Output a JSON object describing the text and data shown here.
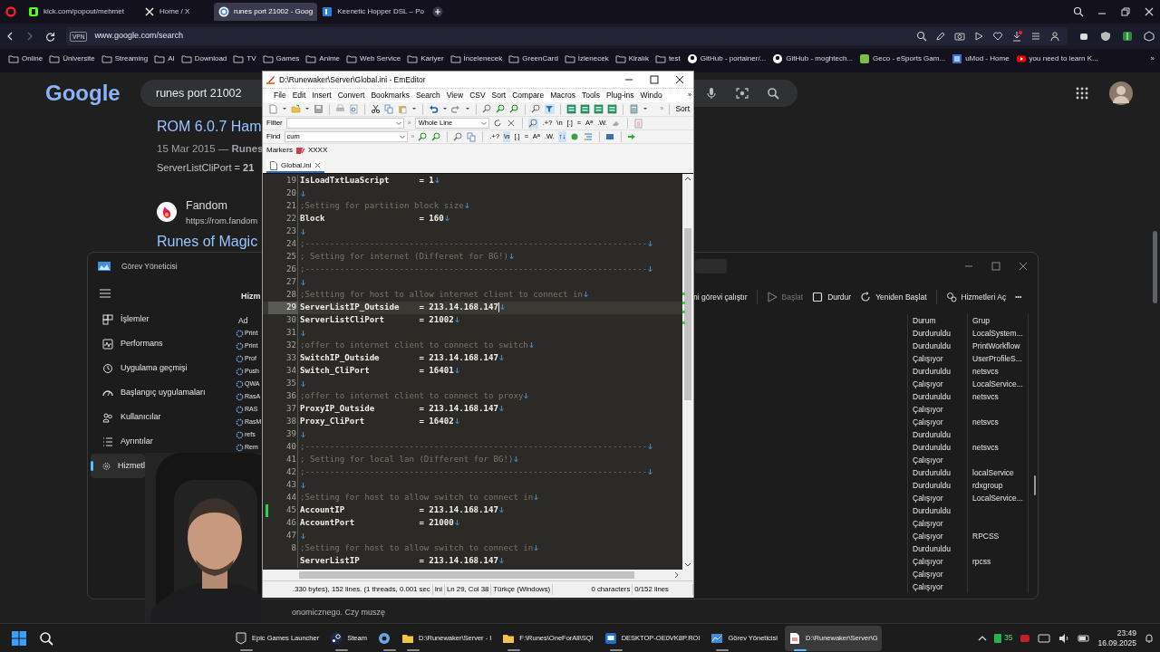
{
  "browser": {
    "tabs": [
      {
        "kind": "kick",
        "label": "kick.com/popout/mehmet",
        "selected": false
      },
      {
        "kind": "x",
        "label": "Home / X",
        "selected": false
      },
      {
        "kind": "google",
        "label": "runes port 21002 - Goog",
        "selected": true
      },
      {
        "kind": "keenetic",
        "label": "Keenetic Hopper DSL – Po",
        "selected": false
      }
    ],
    "vpn": "VPN",
    "address": "www.google.com/search",
    "bookmarks": [
      {
        "kind": "folder",
        "label": "Online"
      },
      {
        "kind": "folder",
        "label": "Üniversite"
      },
      {
        "kind": "folder",
        "label": "Streaming"
      },
      {
        "kind": "folder",
        "label": "AI"
      },
      {
        "kind": "folder",
        "label": "Download"
      },
      {
        "kind": "folder",
        "label": "TV"
      },
      {
        "kind": "folder",
        "label": "Games"
      },
      {
        "kind": "folder",
        "label": "Anime"
      },
      {
        "kind": "folder",
        "label": "Web Service"
      },
      {
        "kind": "folder",
        "label": "Kariyer"
      },
      {
        "kind": "folder",
        "label": "İncelenecek"
      },
      {
        "kind": "folder",
        "label": "GreenCard"
      },
      {
        "kind": "folder",
        "label": "İzlenecek"
      },
      {
        "kind": "folder",
        "label": "Kiralık"
      },
      {
        "kind": "folder",
        "label": "test"
      },
      {
        "kind": "github",
        "label": "GitHub - portainer/..."
      },
      {
        "kind": "github",
        "label": "GitHub - moghtech..."
      },
      {
        "kind": "geco",
        "label": "Geco - eSports Gam..."
      },
      {
        "kind": "umod",
        "label": "uMod - Home"
      },
      {
        "kind": "youtube",
        "label": "you need to learn K..."
      }
    ],
    "bookmarks_more": "»"
  },
  "google": {
    "logo": "Google",
    "query": "runes port 21002",
    "result": {
      "title": "ROM 6.0.7 Ham",
      "meta": "15 Mar 2015 — **Runes**",
      "snippet": "ServerListCliPort = **21**"
    },
    "site_result": {
      "site": "Fandom",
      "url": "https://rom.fandom",
      "title": "Runes of Magic"
    }
  },
  "task_manager": {
    "title": "Görev Yöneticisi",
    "nav": [
      {
        "kind": "processes",
        "label": "İşlemler",
        "selected": false
      },
      {
        "kind": "performance",
        "label": "Performans",
        "selected": false
      },
      {
        "kind": "history",
        "label": "Uygulama geçmişi",
        "selected": false
      },
      {
        "kind": "startup",
        "label": "Başlangıç uygulamaları",
        "selected": false
      },
      {
        "kind": "users",
        "label": "Kullanıcılar",
        "selected": false
      },
      {
        "kind": "details",
        "label": "Ayrıntılar",
        "selected": false
      },
      {
        "kind": "services",
        "label": "Hizmetl",
        "selected": true
      }
    ],
    "page_title": "Hizm",
    "toolbar": [
      {
        "kind": "run",
        "label": "ni görevi çalıştır",
        "disabled": false
      },
      {
        "kind": "start",
        "label": "Başlat",
        "disabled": true
      },
      {
        "kind": "stop",
        "label": "Durdur",
        "disabled": false
      },
      {
        "kind": "restart",
        "label": "Yeniden Başlat",
        "disabled": false
      },
      {
        "kind": "services",
        "label": "Hizmetleri Aç",
        "disabled": false
      }
    ],
    "more": "•••",
    "columns": {
      "name": "Ad",
      "status": "Durum",
      "group": "Grup"
    },
    "rows": [
      {
        "name": "Print",
        "status": "Durduruldu",
        "group": "LocalSystem..."
      },
      {
        "name": "Print",
        "status": "Durduruldu",
        "group": "PrintWorkflow"
      },
      {
        "name": "Prof",
        "status": "Çalışıyor",
        "group": "UserProfileS..."
      },
      {
        "name": "Push",
        "status": "Durduruldu",
        "group": "netsvcs"
      },
      {
        "name": "QWA",
        "status": "Çalışıyor",
        "group": "LocalService..."
      },
      {
        "name": "RasA",
        "status": "Durduruldu",
        "group": "netsvcs"
      },
      {
        "name": "RAS",
        "status": "Çalışıyor"
      },
      {
        "name": "RasM",
        "status": "Çalışıyor",
        "group": "netsvcs"
      },
      {
        "name": "refs",
        "status": "Durduruldu"
      },
      {
        "name": "Rem",
        "status": "Durduruldu",
        "group": "netsvcs"
      },
      {
        "status": "Çalışıyor"
      },
      {
        "status": "Durduruldu",
        "group": "localService"
      },
      {
        "status": "Durduruldu",
        "group": "rdxgroup"
      },
      {
        "status": "Çalışıyor",
        "group": "LocalService..."
      },
      {
        "status": "Durduruldu"
      },
      {
        "status": "Çalışıyor"
      },
      {
        "status": "Çalışıyor",
        "group": "RPCSS"
      },
      {
        "status": "Durduruldu"
      },
      {
        "status": "Çalışıyor",
        "group": "rpcss"
      },
      {
        "status": "Çalışıyor"
      },
      {
        "status": "Çalışıyor"
      }
    ]
  },
  "editor": {
    "title": "D:\\Runewaker\\Server\\Global.ini - EmEditor",
    "menu": [
      "File",
      "Edit",
      "Insert",
      "Convert",
      "Bookmarks",
      "Search",
      "View",
      "CSV",
      "Sort",
      "Compare",
      "Macros",
      "Tools",
      "Plug-ins",
      "Windo"
    ],
    "more": "»",
    "sort": "Sort",
    "filter": {
      "label": "Filter",
      "mode": "Whole Line",
      "options": [
        {
          "label": ".+?",
          "on": false
        },
        {
          "label": "\\n",
          "on": false
        },
        {
          "label": "[.]",
          "on": false
        },
        {
          "label": "≈",
          "on": false
        },
        {
          "label": "A$^{a}$",
          "on": false
        },
        {
          "label": ".W.",
          "on": false
        }
      ]
    },
    "find": {
      "label": "Find",
      "value": "cum",
      "options": [
        {
          "label": ".+?",
          "on": false
        },
        {
          "label": "\\n",
          "on": true
        },
        {
          "label": "[.]",
          "on": false
        },
        {
          "label": "≈",
          "on": false
        },
        {
          "label": "A$^{a}$",
          "on": false
        },
        {
          "label": ".W.",
          "on": false
        },
        {
          "label": "↑↓",
          "on": true
        }
      ]
    },
    "markers": {
      "label": "Markers",
      "marker": "XXXX"
    },
    "tabs": [
      {
        "label": "Global.ini",
        "selected": true
      }
    ],
    "lines": [
      {
        "n": "19",
        "kind": "key",
        "key": "IsLoadTxtLuaScript",
        "value": "= 1",
        "current": false,
        "modified": false
      },
      {
        "n": "20",
        "kind": "blank",
        "current": false,
        "modified": false
      },
      {
        "n": "21",
        "kind": "comment",
        "text": ";Setting for partition block size",
        "current": false,
        "modified": false
      },
      {
        "n": "22",
        "kind": "key",
        "key": "Block",
        "value": "= 160",
        "current": false,
        "modified": false
      },
      {
        "n": "23",
        "kind": "blank",
        "current": false,
        "modified": false
      },
      {
        "n": "24",
        "kind": "comment",
        "text": ";---------------------------------------------------------------------",
        "current": false,
        "modified": false
      },
      {
        "n": "25",
        "kind": "comment",
        "text": "; Setting for internet (Different for BG!)",
        "current": false,
        "modified": false
      },
      {
        "n": "26",
        "kind": "comment",
        "text": ";---------------------------------------------------------------------",
        "current": false,
        "modified": false
      },
      {
        "n": "27",
        "kind": "blank",
        "current": false,
        "modified": false
      },
      {
        "n": "28",
        "kind": "comment",
        "text": ";Settting for host to allow internet client to connect in",
        "current": false,
        "modified": false
      },
      {
        "n": "29",
        "kind": "key",
        "key": "ServerListIP_Outside",
        "value": "= 213.14.168.147",
        "current": true,
        "modified": false
      },
      {
        "n": "30",
        "kind": "key",
        "key": "ServerListCliPort",
        "value": "= 21002",
        "current": false,
        "modified": false
      },
      {
        "n": "31",
        "kind": "blank",
        "current": false,
        "modified": false
      },
      {
        "n": "32",
        "kind": "comment",
        "text": ";offer to internet client to connect to switch",
        "current": false,
        "modified": false
      },
      {
        "n": "33",
        "kind": "key",
        "key": "SwitchIP_Outside",
        "value": "= 213.14.168.147",
        "current": false,
        "modified": false
      },
      {
        "n": "34",
        "kind": "key",
        "key": "Switch_CliPort",
        "value": "= 16401",
        "current": false,
        "modified": false
      },
      {
        "n": "35",
        "kind": "blank",
        "current": false,
        "modified": false
      },
      {
        "n": "36",
        "kind": "comment",
        "text": ";offer to internet client to connect to proxy",
        "current": false,
        "modified": false
      },
      {
        "n": "37",
        "kind": "key",
        "key": "ProxyIP_Outside",
        "value": "= 213.14.168.147",
        "current": false,
        "modified": false
      },
      {
        "n": "38",
        "kind": "key",
        "key": "Proxy_CliPort",
        "value": "= 16402",
        "current": false,
        "modified": false
      },
      {
        "n": "39",
        "kind": "blank",
        "current": false,
        "modified": false
      },
      {
        "n": "40",
        "kind": "comment",
        "text": ";---------------------------------------------------------------------",
        "current": false,
        "modified": false
      },
      {
        "n": "41",
        "kind": "comment",
        "text": "; Setting for local lan (Different for BG!)",
        "current": false,
        "modified": false
      },
      {
        "n": "42",
        "kind": "comment",
        "text": ";---------------------------------------------------------------------",
        "current": false,
        "modified": false
      },
      {
        "n": "43",
        "kind": "blank",
        "current": false,
        "modified": false
      },
      {
        "n": "44",
        "kind": "comment",
        "text": ";Setting for host to allow switch to connect in",
        "current": false,
        "modified": false
      },
      {
        "n": "45",
        "kind": "key",
        "key": "AccountIP",
        "value": "= 213.14.168.147",
        "current": false,
        "modified": true
      },
      {
        "n": "46",
        "kind": "key",
        "key": "AccountPort",
        "value": "= 21000",
        "current": false,
        "modified": false
      },
      {
        "n": "47",
        "kind": "blank",
        "current": false,
        "modified": false
      },
      {
        "n": "8",
        "kind": "comment",
        "text": ";Setting for host to allow switch to connect in",
        "current": false,
        "modified": false
      },
      {
        "kind": "key",
        "key": "ServerListIP",
        "value": "= 213.14.168.147",
        "current": false,
        "modified": false
      }
    ],
    "status": [
      ".330 bytes), 152 lines. (1 threads, 0.001 sec",
      "Ini",
      "Ln 29, Col 38",
      "Türkçe (Windows)",
      "0 characters",
      "0/152 lines"
    ]
  },
  "caption": "onomicznego. Czy muszę",
  "taskbar": {
    "apps": [
      {
        "kind": "epic",
        "label": "Epic Games Launcher",
        "active": false
      },
      {
        "kind": "steam",
        "label": "Steam",
        "active": false
      },
      {
        "kind": "app",
        "active": false
      },
      {
        "kind": "folder",
        "label": "D:\\Runewaker\\Server - I",
        "active": false
      },
      {
        "kind": "folder",
        "label": "F:\\Runes\\OneForAll\\SQI",
        "active": false
      },
      {
        "kind": "remote",
        "label": "DESKTOP-OE0VK8P.ROI",
        "active": false
      },
      {
        "kind": "taskmgr",
        "label": "Görev Yöneticisi",
        "active": false
      },
      {
        "kind": "editor",
        "label": "D:\\Runewaker\\Server\\G",
        "active": true
      }
    ],
    "tray_badge": "35",
    "time": "23:49",
    "date": "16.09.2025"
  }
}
